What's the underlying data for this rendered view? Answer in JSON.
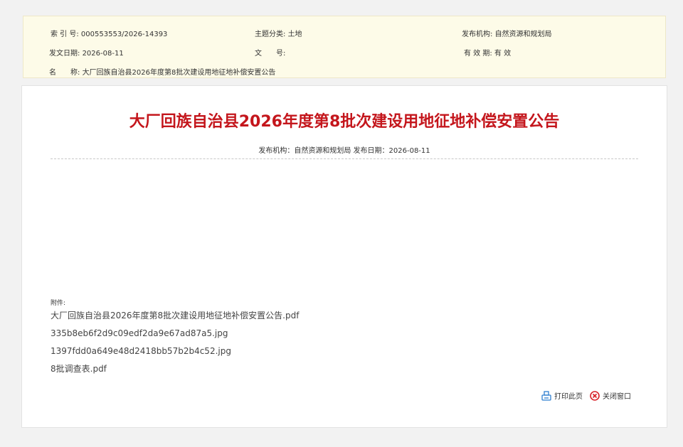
{
  "meta": {
    "index_label": "索 引 号:",
    "index_value": "000553553/2026-14393",
    "topic_label": "主题分类:",
    "topic_value": "土地",
    "issuer_label": "发布机构:",
    "issuer_value": "自然资源和规划局",
    "date_label": "发文日期:",
    "date_value": "2026-08-11",
    "docno_label": "文　　号:",
    "docno_value": "",
    "validity_label": "有 效 期:",
    "validity_value": "有 效",
    "name_label": "名　　称:",
    "name_value": "大厂回族自治县2026年度第8批次建设用地征地补偿安置公告"
  },
  "article": {
    "title": "大厂回族自治县2026年度第8批次建设用地征地补偿安置公告",
    "pub_info": "发布机构：自然资源和规划局 发布日期：2026-08-11"
  },
  "attachments": {
    "label": "附件:",
    "items": [
      "大厂回族自治县2026年度第8批次建设用地征地补偿安置公告.pdf",
      "335b8eb6f2d9c09edf2da9e67ad87a5.jpg",
      "1397fdd0a649e48d2418bb57b2b4c52.jpg",
      "8批调查表.pdf"
    ]
  },
  "actions": {
    "print_label": "打印此页",
    "close_label": "关闭窗口",
    "print_icon": "printer-icon",
    "close_icon": "close-circle-icon"
  },
  "colors": {
    "title": "#c4161c",
    "meta_bg": "#fdfbe8",
    "print_icon": "#2f7fd0",
    "close_icon": "#d8232a"
  }
}
